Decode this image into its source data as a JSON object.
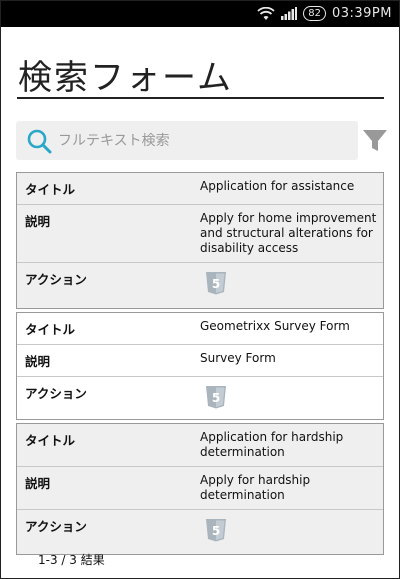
{
  "status_bar": {
    "battery": "82",
    "time": "03:39PM"
  },
  "page": {
    "title": "検索フォーム"
  },
  "search": {
    "placeholder": "フルテキスト検索"
  },
  "icons": {
    "search": "search-icon",
    "filter": "filter-icon",
    "action": "html5-form-icon"
  },
  "colors": {
    "search_accent": "#2aa7c9",
    "filter_gray": "#999999",
    "card_gray": "#efefef"
  },
  "results": [
    {
      "title_label": "タイトル",
      "title": "Application for assistance",
      "description_label": "説明",
      "description": "Apply for home improvement and structural alterations for disability access",
      "action_label": "アクション"
    },
    {
      "title_label": "タイトル",
      "title": "Geometrixx Survey Form",
      "description_label": "説明",
      "description": "Survey Form",
      "action_label": "アクション"
    },
    {
      "title_label": "タイトル",
      "title": "Application for hardship determination",
      "description_label": "説明",
      "description": "Apply for hardship determination",
      "action_label": "アクション"
    }
  ],
  "footer": {
    "result_count": "1-3 / 3 結果"
  }
}
